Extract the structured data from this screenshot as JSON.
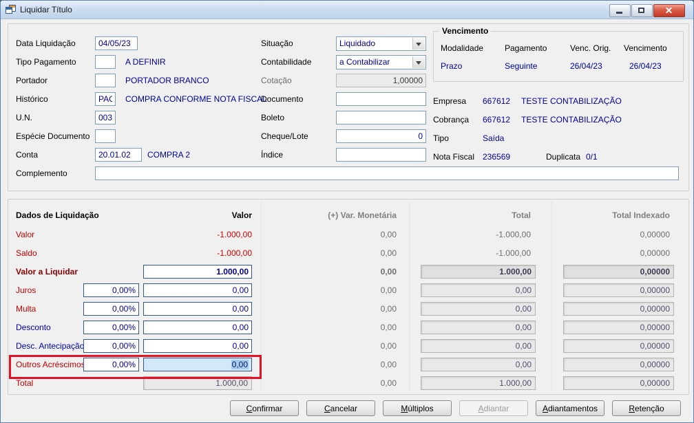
{
  "window": {
    "title": "Liquidar Título"
  },
  "colors": {
    "value_text": "#00009b",
    "label_red": "#c00000",
    "label_blue": "#0000b4",
    "valor_a_liquidar_label": "#8b0000",
    "negative_value": "#d40000",
    "muted_text": "#6d6d6d",
    "annotation": "#e81123",
    "selected_field_bg": "#d3e9fa",
    "titlebar": "#c9daf0",
    "window_bg": "#f0f0f0"
  },
  "top": {
    "data_liquidacao": {
      "label": "Data Liquidação",
      "value": "04/05/23"
    },
    "tipo_pagamento": {
      "label": "Tipo Pagamento",
      "value": "",
      "desc": "A DEFINIR"
    },
    "portador": {
      "label": "Portador",
      "value": "",
      "desc": "PORTADOR BRANCO"
    },
    "historico": {
      "label": "Histórico",
      "value": "PAG",
      "desc": "COMPRA CONFORME NOTA FISCAL"
    },
    "un": {
      "label": "U.N.",
      "value": "003"
    },
    "especie_documento": {
      "label": "Espécie Documento",
      "value": ""
    },
    "conta": {
      "label": "Conta",
      "value": "20.01.02",
      "desc": "COMPRA 2"
    },
    "complemento": {
      "label": "Complemento",
      "value": ""
    },
    "situacao": {
      "label": "Situação",
      "value": "Liquidado"
    },
    "contabilidade": {
      "label": "Contabilidade",
      "value": "a Contabilizar"
    },
    "cotacao": {
      "label": "Cotação",
      "value": "1,00000"
    },
    "documento": {
      "label": "Documento",
      "value": ""
    },
    "boleto": {
      "label": "Boleto",
      "value": ""
    },
    "cheque_lote": {
      "label": "Cheque/Lote",
      "value": "0"
    },
    "indice": {
      "label": "Índice",
      "value": ""
    }
  },
  "vencimento": {
    "title": "Vencimento",
    "headers": [
      "Modalidade",
      "Pagamento",
      "Venc. Orig.",
      "Vencimento"
    ],
    "values": [
      "Prazo",
      "Seguinte",
      "26/04/23",
      "26/04/23"
    ]
  },
  "info": {
    "empresa": {
      "label": "Empresa",
      "code": "667612",
      "desc": "TESTE CONTABILIZAÇÃO"
    },
    "cobranca": {
      "label": "Cobrança",
      "code": "667612",
      "desc": "TESTE CONTABILIZAÇÃO"
    },
    "tipo": {
      "label": "Tipo",
      "value": "Saída"
    },
    "nota_fiscal": {
      "label": "Nota Fiscal",
      "value": "236569"
    },
    "duplicata": {
      "label": "Duplicata",
      "value": "0/1"
    }
  },
  "grid": {
    "headers": {
      "dados": "Dados de Liquidação",
      "valor": "Valor",
      "var": "(+) Var. Monetária",
      "total": "Total",
      "indexado": "Total Indexado"
    },
    "rows": [
      {
        "label": "Valor",
        "valor": "-1.000,00",
        "var": "0,00",
        "total": "-1.000,00",
        "indexado": "0,00000"
      },
      {
        "label": "Saldo",
        "valor": "-1.000,00",
        "var": "0,00",
        "total": "-1.000,00",
        "indexado": "0,00000"
      },
      {
        "label": "Valor a Liquidar",
        "valor": "1.000,00",
        "var": "0,00",
        "total": "1.000,00",
        "indexado": "0,00000"
      },
      {
        "label": "Juros",
        "pct": "0,00%",
        "valor": "0,00",
        "var": "0,00",
        "total": "0,00",
        "indexado": "0,00000"
      },
      {
        "label": "Multa",
        "pct": "0,00%",
        "valor": "0,00",
        "var": "0,00",
        "total": "0,00",
        "indexado": "0,00000"
      },
      {
        "label": "Desconto",
        "pct": "0,00%",
        "valor": "0,00",
        "var": "0,00",
        "total": "0,00",
        "indexado": "0,00000"
      },
      {
        "label": "Desc. Antecipação",
        "pct": "0,00%",
        "valor": "0,00",
        "var": "0,00",
        "total": "0,00",
        "indexado": "0,00000"
      },
      {
        "label": "Outros Acréscimos",
        "pct": "0,00%",
        "valor": "0,00",
        "var": "0,00",
        "total": "0,00",
        "indexado": "0,00000"
      },
      {
        "label": "Total",
        "valor": "1.000,00",
        "var": "0,00",
        "total": "1.000,00",
        "indexado": "0,00000"
      }
    ]
  },
  "buttons": [
    {
      "label": "Confirmar"
    },
    {
      "label": "Cancelar"
    },
    {
      "label": "Múltiplos"
    },
    {
      "label": "Adiantar"
    },
    {
      "label": "Adiantamentos"
    },
    {
      "label": "Retenção"
    }
  ]
}
